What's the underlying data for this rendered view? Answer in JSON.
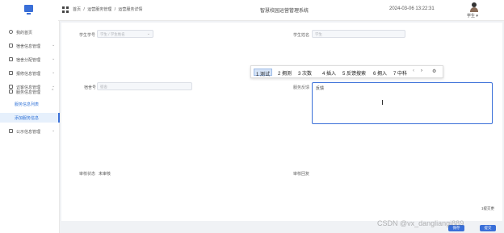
{
  "header": {
    "breadcrumb": [
      "首页",
      "/",
      "运营服务管理",
      "/",
      "运营服务详情"
    ],
    "system_title": "智慧校园运营管理系统",
    "clock": "2024-03-06 13:22:31",
    "user_name": "学生",
    "user_caret": "▾"
  },
  "sidebar": {
    "items": [
      {
        "label": "我的首页",
        "icon": "home-icon"
      },
      {
        "label": "宿舍信息管理",
        "icon": "building-icon",
        "chevron": "⌄"
      },
      {
        "label": "宿舍分配管理",
        "icon": "assign-icon",
        "chevron": "⌄"
      },
      {
        "label": "报修信息管理",
        "icon": "repair-icon",
        "chevron": "⌄"
      },
      {
        "label": "访客信息管理",
        "icon": "visitor-icon",
        "chevron": "⌄"
      },
      {
        "label": "服务信息管理",
        "icon": "service-icon",
        "chevron": "^"
      }
    ],
    "subitems": [
      {
        "label": "服务信息列表"
      },
      {
        "label": "添加服务信息"
      }
    ],
    "last_item": {
      "label": "公示信息管理",
      "icon": "notice-icon",
      "chevron": "⌄"
    }
  },
  "form": {
    "student_id_label": "学生学号",
    "student_id_placeholder": "学生 / 学生姓名",
    "student_name_label": "学生姓名",
    "student_name_placeholder": "学生",
    "dorm_label": "宿舍号",
    "dorm_placeholder": "宿舍",
    "feedback_label": "服务反馈",
    "feedback_text": "反馈",
    "review_status_label": "审核状态",
    "review_status_value": "未审核",
    "review_reply_label": "审核回复"
  },
  "ime": {
    "candidates": [
      "1 测试",
      "2 拥测",
      "3 次数",
      "4 插入",
      "5 反馈搜索",
      "6 拥入",
      "7 中科"
    ],
    "prev": "‹",
    "next": "›",
    "settings_icon": "gear-icon",
    "selected_index": 0
  },
  "footer": {
    "hint": "1提交更",
    "save_label": "保存",
    "submit_label": "提交"
  },
  "watermark": "CSDN @vx_dangliangi889",
  "colors": {
    "accent": "#3a6fd8",
    "sidebar_active_bg": "#e6f0fc"
  }
}
